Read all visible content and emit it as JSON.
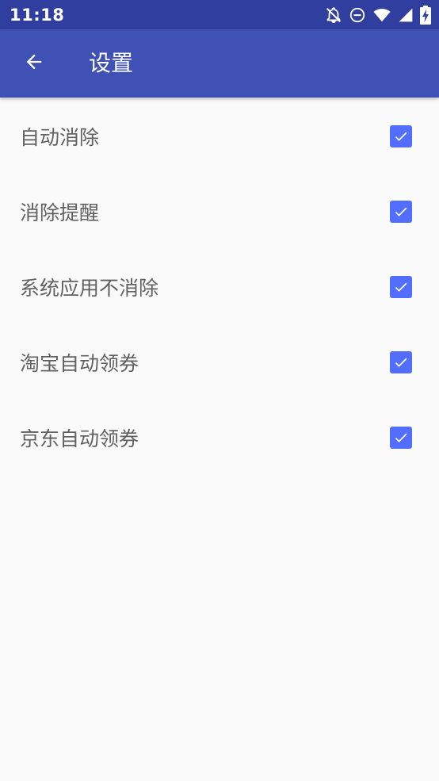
{
  "status_bar": {
    "time": "11:18",
    "icons": [
      "notifications-off-icon",
      "do-not-disturb-icon",
      "wifi-icon",
      "cell-signal-icon",
      "battery-charging-icon"
    ]
  },
  "app_bar": {
    "back_icon": "arrow-back-icon",
    "title": "设置"
  },
  "settings": [
    {
      "label": "自动消除",
      "checked": true
    },
    {
      "label": "消除提醒",
      "checked": true
    },
    {
      "label": "系统应用不消除",
      "checked": true
    },
    {
      "label": "淘宝自动领券",
      "checked": true
    },
    {
      "label": "京东自动领券",
      "checked": true
    }
  ],
  "colors": {
    "status_bar": "#303f9f",
    "app_bar": "#3f51b5",
    "checkbox": "#536dfe",
    "background": "#fafafa",
    "label_text": "#616161"
  }
}
